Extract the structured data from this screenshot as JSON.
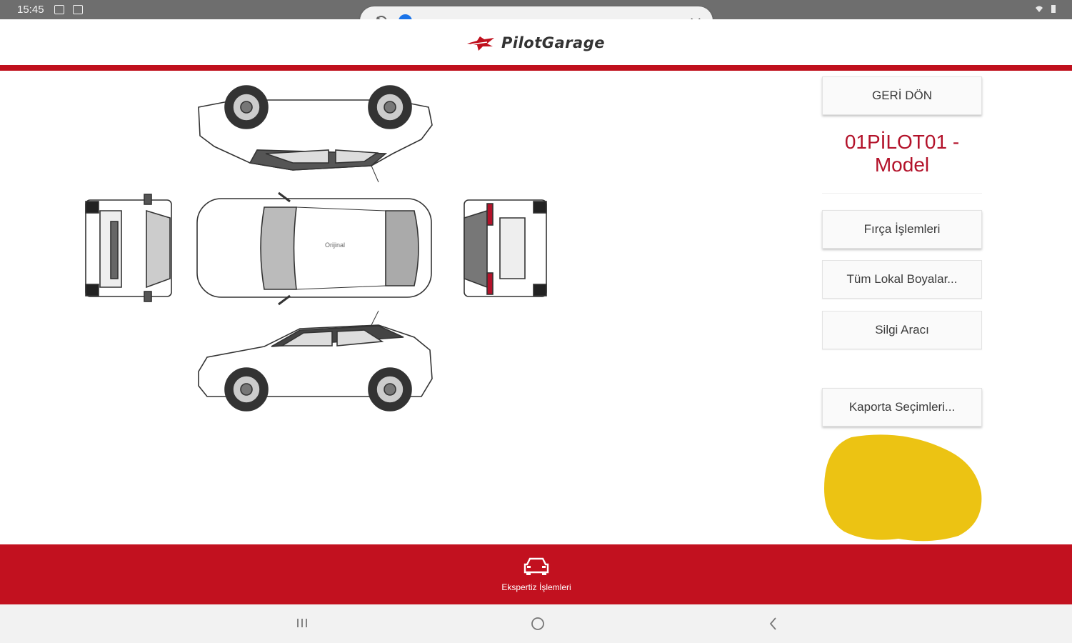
{
  "status_bar": {
    "time": "15:45"
  },
  "media_control": {
    "progress_fraction": 0.0
  },
  "header": {
    "brand": "PilotGarage"
  },
  "panel": {
    "back_button": "GERİ DÖN",
    "plate_line1": "01PİLOT01 -",
    "plate_line2": "Model",
    "brush_button": "Fırça İşlemleri",
    "local_paint_button": "Tüm Lokal Boyalar...",
    "eraser_button": "Silgi Aracı",
    "body_selection_button": "Kaporta Seçimleri..."
  },
  "diagram": {
    "badge_text": "Orijinal"
  },
  "colors": {
    "accent_red": "#c2111f",
    "selected_color": "#ecc313"
  },
  "bottom_nav": {
    "tab_label": "Ekspertiz İşlemleri",
    "tab_icon": "car-icon"
  }
}
